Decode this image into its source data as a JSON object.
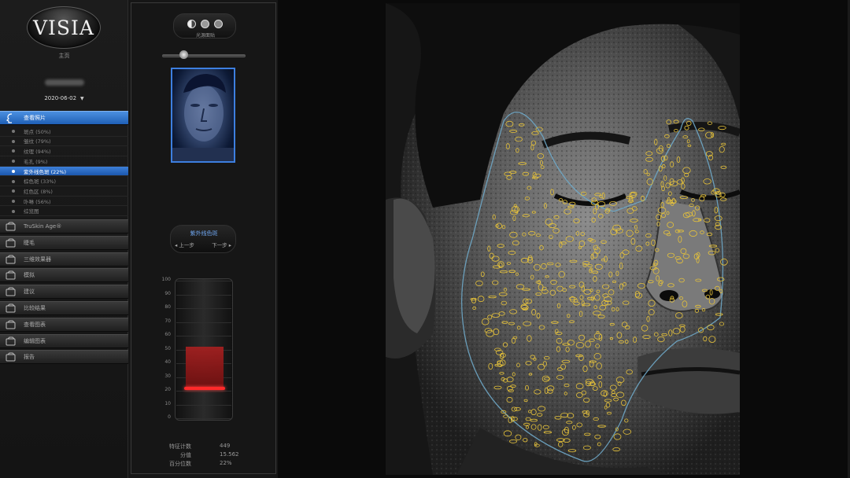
{
  "app": {
    "logo_text": "VISIA",
    "home_label": "主页",
    "date": "2020-06-02"
  },
  "nav": {
    "view_photos": "查看照片",
    "sub_items": [
      "斑点 (50%)",
      "皱纹 (79%)",
      "纹理 (94%)",
      "毛孔 (9%)",
      "紫外线色斑 (22%)",
      "棕色斑 (33%)",
      "红色区 (8%)",
      "卟啉 (56%)",
      "综览图"
    ],
    "selected_sub": "紫外线色斑 (22%)",
    "sections": [
      "TruSkin Age®",
      "睫毛",
      "三维效果器",
      "模拟",
      "建议",
      "比较结果",
      "查看图表",
      "编辑图表",
      "报告"
    ]
  },
  "panel": {
    "tool_caption": "光源面贴",
    "mode_title": "紫外线色斑",
    "prev_label": "◂ 上一步",
    "next_label": "下一步 ▸",
    "gauge_axis": [
      "100",
      "90",
      "80",
      "70",
      "60",
      "50",
      "40",
      "30",
      "20",
      "10",
      "0"
    ],
    "stats": [
      {
        "label": "特征计数",
        "value": "449"
      },
      {
        "label": "分值",
        "value": "15.562"
      },
      {
        "label": "百分位数",
        "value": "22%"
      }
    ]
  },
  "percentile": 22,
  "slider_fraction": 0.25,
  "colors": {
    "accent_blue": "#3d7fd8",
    "gauge_red": "#a32020",
    "marker_red": "#ff2a2a",
    "overlay_yellow": "#e6c23a",
    "contour_blue": "#6fa8c8"
  }
}
